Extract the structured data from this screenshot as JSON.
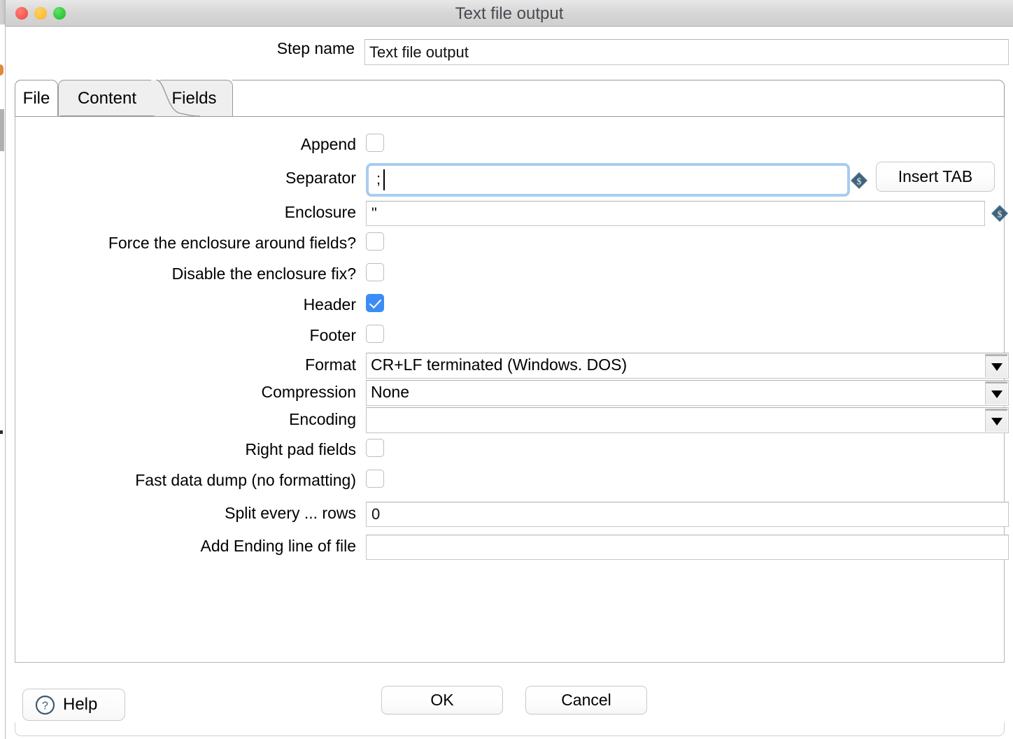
{
  "window": {
    "title": "Text file output",
    "traffic_lights": [
      "close-red",
      "minimize-amber",
      "zoom-green"
    ]
  },
  "step": {
    "label": "Step name",
    "value": "Text file output",
    "placeholder": ""
  },
  "tabs": [
    {
      "label": "File",
      "active": false
    },
    {
      "label": "Content",
      "active": true
    },
    {
      "label": "Fields",
      "active": false
    }
  ],
  "content": {
    "append": {
      "label": "Append",
      "checked": false
    },
    "separator": {
      "label": "Separator",
      "value": ";",
      "focused": true,
      "var_icon": "dollar-variable-icon"
    },
    "insert_tab": {
      "label": "Insert TAB"
    },
    "enclosure": {
      "label": "Enclosure",
      "value": "\"",
      "var_icon": "dollar-variable-icon"
    },
    "force_enclosure": {
      "label": "Force the enclosure around fields?",
      "checked": false
    },
    "disable_fix": {
      "label": "Disable the enclosure fix?",
      "checked": false
    },
    "header": {
      "label": "Header",
      "checked": true
    },
    "footer": {
      "label": "Footer",
      "checked": false
    },
    "format": {
      "label": "Format",
      "value": "CR+LF terminated (Windows. DOS)"
    },
    "compression": {
      "label": "Compression",
      "value": "None"
    },
    "encoding": {
      "label": "Encoding",
      "value": ""
    },
    "right_pad": {
      "label": "Right pad fields",
      "checked": false
    },
    "fast_dump": {
      "label": "Fast data dump (no formatting)",
      "checked": false
    },
    "split_rows": {
      "label": "Split every ... rows",
      "value": "0"
    },
    "ending_line": {
      "label": "Add Ending line of file",
      "value": ""
    }
  },
  "footer_buttons": {
    "help": "Help",
    "ok": "OK",
    "cancel": "Cancel"
  },
  "colors": {
    "accent_checkbox": "#3b8cf4",
    "focus_ring": "#a9cdf0",
    "var_icon": "#4a6f8a",
    "titlebar": "#d6d6d6",
    "tab_active_bg": "#efefef"
  }
}
